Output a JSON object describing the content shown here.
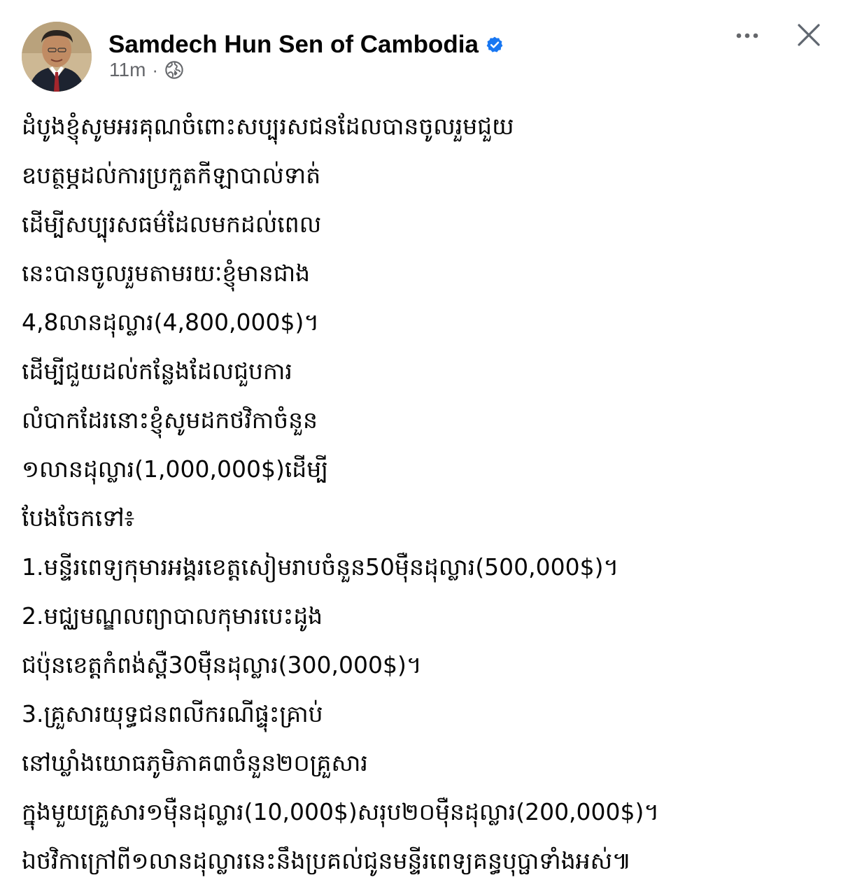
{
  "post": {
    "author": "Samdech Hun Sen of Cambodia",
    "time": "11m",
    "separator": "·",
    "icons": {
      "verified": "verified-badge-icon",
      "audience": "globe-icon",
      "more": "more-options-icon",
      "close": "close-icon"
    },
    "colors": {
      "verified": "#1877f2",
      "meta": "#65676b",
      "text": "#050505"
    },
    "lines": [
      "ដំបូងខ្ញុំសូមអរគុណចំពោះសប្បុរសជនដែលបានចូលរួមជួយ",
      "ឧបត្ថម្ភដល់ការប្រកួតកីឡាបាល់ទាត់",
      "ដើម្បីសប្បុរសធម៌ដែលមកដល់ពេល",
      "នេះបានចូលរួមតាមរយៈខ្ញុំមានជាង",
      "4,8លានដុល្លារ(4,800,000$)។",
      "ដើម្បីជួយដល់កន្លែងដែលជួបការ",
      "លំបាកដែរនោះខ្ញុំសូមដកថវិកាចំនួន",
      "១លានដុល្លារ(1,000,000$)ដើម្បី",
      "បែងចែកទៅ៖",
      "1.មន្ទីរពេទ្យកុមារអង្គរខេត្តសៀមរាបចំនួន50ម៉ឺនដុល្លារ(500,000$)។",
      "2.មជ្ឈមណ្ឌលព្យាបាលកុមារបេះដូង",
      "ជប៉ុនខេត្តកំពង់ស្ពឺ30ម៉ឺនដុល្លារ(300,000$)។",
      "3.គ្រួសារយុទ្ធជនពលីករណីផ្ទុះគ្រាប់",
      "នៅឃ្លាំងយោធភូមិភាគ៣ចំនួន២០គ្រួសារ",
      "ក្នុងមួយគ្រួសារ១ម៉ឺនដុល្លារ(10,000$)សរុប២០ម៉ឺនដុល្លារ(200,000$)។",
      "ឯថវិកាក្រៅពី១លានដុល្លារនេះនឹងប្រគល់ជូនមន្ទីរពេទ្យគន្ធបុប្ផាទាំងអស់៕"
    ]
  }
}
